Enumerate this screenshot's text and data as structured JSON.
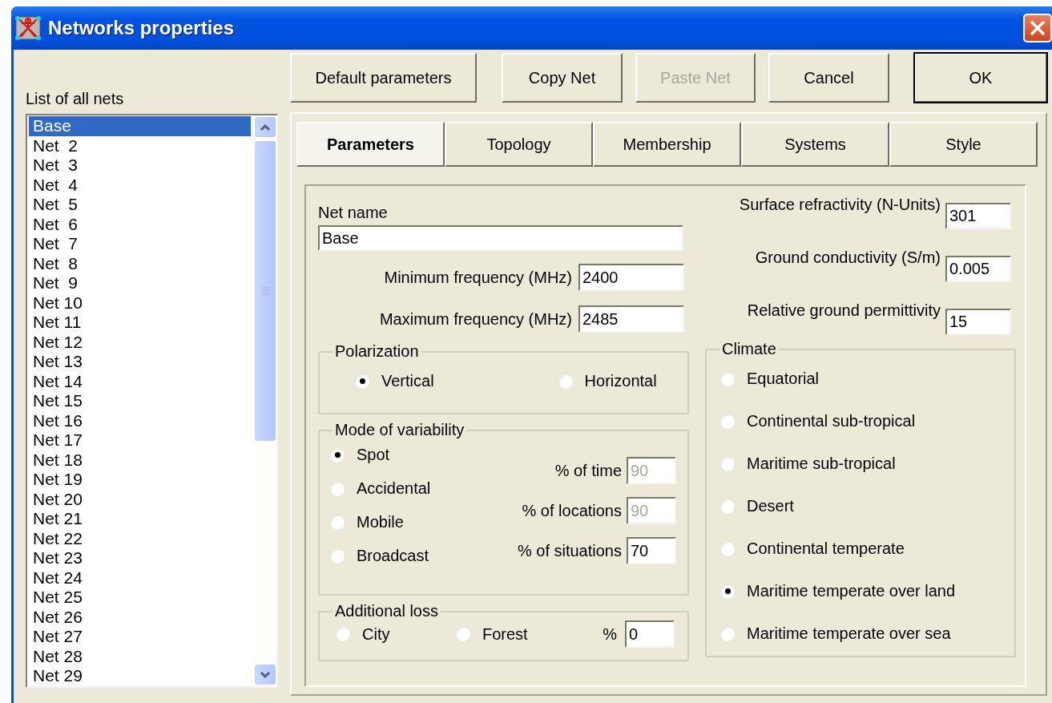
{
  "window": {
    "title": "Networks properties"
  },
  "net_list": {
    "label": "List of all nets",
    "items": [
      {
        "label": "Base",
        "selected": true
      },
      {
        "label": "Net  2",
        "selected": false
      },
      {
        "label": "Net  3",
        "selected": false
      },
      {
        "label": "Net  4",
        "selected": false
      },
      {
        "label": "Net  5",
        "selected": false
      },
      {
        "label": "Net  6",
        "selected": false
      },
      {
        "label": "Net  7",
        "selected": false
      },
      {
        "label": "Net  8",
        "selected": false
      },
      {
        "label": "Net  9",
        "selected": false
      },
      {
        "label": "Net 10",
        "selected": false
      },
      {
        "label": "Net 11",
        "selected": false
      },
      {
        "label": "Net 12",
        "selected": false
      },
      {
        "label": "Net 13",
        "selected": false
      },
      {
        "label": "Net 14",
        "selected": false
      },
      {
        "label": "Net 15",
        "selected": false
      },
      {
        "label": "Net 16",
        "selected": false
      },
      {
        "label": "Net 17",
        "selected": false
      },
      {
        "label": "Net 18",
        "selected": false
      },
      {
        "label": "Net 19",
        "selected": false
      },
      {
        "label": "Net 20",
        "selected": false
      },
      {
        "label": "Net 21",
        "selected": false
      },
      {
        "label": "Net 22",
        "selected": false
      },
      {
        "label": "Net 23",
        "selected": false
      },
      {
        "label": "Net 24",
        "selected": false
      },
      {
        "label": "Net 25",
        "selected": false
      },
      {
        "label": "Net 26",
        "selected": false
      },
      {
        "label": "Net 27",
        "selected": false
      },
      {
        "label": "Net 28",
        "selected": false
      },
      {
        "label": "Net 29",
        "selected": false
      }
    ]
  },
  "buttons": [
    {
      "label": "Default parameters",
      "disabled": false,
      "default": false
    },
    {
      "label": "Copy Net",
      "disabled": false,
      "default": false
    },
    {
      "label": "Paste Net",
      "disabled": true,
      "default": false
    },
    {
      "label": "Cancel",
      "disabled": false,
      "default": false
    },
    {
      "label": "OK",
      "disabled": false,
      "default": true
    }
  ],
  "tabs": [
    {
      "label": "Parameters",
      "selected": true
    },
    {
      "label": "Topology",
      "selected": false
    },
    {
      "label": "Membership",
      "selected": false
    },
    {
      "label": "Systems",
      "selected": false
    },
    {
      "label": "Style",
      "selected": false
    }
  ],
  "net_name": {
    "label": "Net name",
    "value": "Base"
  },
  "frequencies": [
    {
      "label": "Minimum frequency (MHz)",
      "value": "2400"
    },
    {
      "label": "Maximum frequency (MHz)",
      "value": "2485"
    }
  ],
  "ground": [
    {
      "label": "Surface refractivity (N-Units)",
      "value": "301"
    },
    {
      "label": "Ground conductivity (S/m)",
      "value": "0.005"
    },
    {
      "label": "Relative ground permittivity",
      "value": "15"
    }
  ],
  "polarization": {
    "title": "Polarization",
    "options": [
      {
        "label": "Vertical",
        "selected": true
      },
      {
        "label": "Horizontal",
        "selected": false
      }
    ]
  },
  "variability": {
    "title": "Mode of variability",
    "options": [
      {
        "label": "Spot",
        "selected": true
      },
      {
        "label": "Accidental",
        "selected": false
      },
      {
        "label": "Mobile",
        "selected": false
      },
      {
        "label": "Broadcast",
        "selected": false
      }
    ],
    "fields": [
      {
        "label": "% of time",
        "value": "90",
        "disabled": true
      },
      {
        "label": "% of locations",
        "value": "90",
        "disabled": true
      },
      {
        "label": "% of situations",
        "value": "70",
        "disabled": false
      }
    ]
  },
  "additional_loss": {
    "title": "Additional loss",
    "options": [
      {
        "label": "City",
        "selected": false
      },
      {
        "label": "Forest",
        "selected": false
      }
    ],
    "field": {
      "label": "%",
      "value": "0"
    }
  },
  "climate": {
    "title": "Climate",
    "options": [
      {
        "label": "Equatorial",
        "selected": false
      },
      {
        "label": "Continental sub-tropical",
        "selected": false
      },
      {
        "label": "Maritime sub-tropical",
        "selected": false
      },
      {
        "label": "Desert",
        "selected": false
      },
      {
        "label": "Continental temperate",
        "selected": false
      },
      {
        "label": "Maritime temperate over land",
        "selected": true
      },
      {
        "label": "Maritime temperate over sea",
        "selected": false
      }
    ]
  }
}
